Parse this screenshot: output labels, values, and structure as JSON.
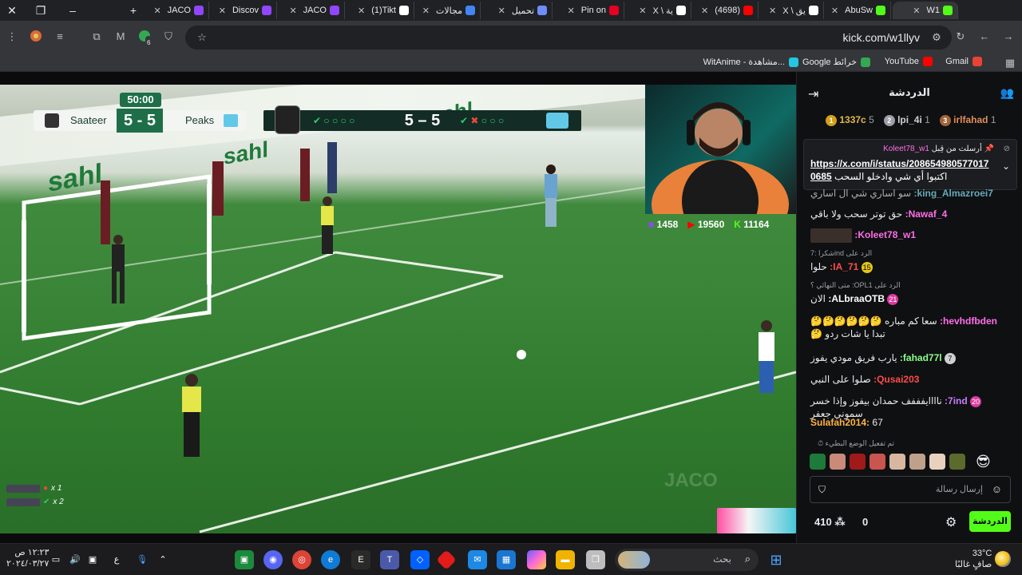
{
  "tabs": [
    {
      "label": "JACO",
      "color": "#9146ff"
    },
    {
      "label": "Discov",
      "color": "#9146ff"
    },
    {
      "label": "JACO",
      "color": "#9146ff"
    },
    {
      "label": "(1)Tikt",
      "color": "#ffffff"
    },
    {
      "label": "مجالات",
      "color": "#4285f4"
    },
    {
      "label": "تحميل",
      "color": "#6f8cff"
    },
    {
      "label": "Pin on",
      "color": "#e60023"
    },
    {
      "label": "X \\ ية",
      "color": "#ffffff"
    },
    {
      "label": "(4698)",
      "color": "#ff0000"
    },
    {
      "label": "X \\ يق",
      "color": "#ffffff"
    },
    {
      "label": "AbuSw",
      "color": "#53fc18"
    },
    {
      "label": "W1",
      "color": "#53fc18"
    }
  ],
  "toolbar": {
    "url": "kick.com/w1llyv",
    "extension_badge": "6"
  },
  "bookmarks": [
    {
      "label": "Gmail",
      "color": "#ea4335"
    },
    {
      "label": "YouTube",
      "color": "#ff0000"
    },
    {
      "label": "Google خرائط",
      "color": "#34a853"
    },
    {
      "label": "WitAnime - مشاهدة...",
      "color": "#23c7e0"
    }
  ],
  "scoreboard": {
    "time": "50:00",
    "team_left": "Saateer",
    "score": "5 - 5",
    "team_right": "Peaks",
    "pen_score": "5 – 5"
  },
  "stream_stats": {
    "twitch": "1458",
    "youtube": "19560",
    "kick": "11164"
  },
  "watermark": "JACO",
  "overlay_bottom_left": [
    {
      "label": "x 1"
    },
    {
      "label": "x 2"
    }
  ],
  "chat": {
    "title": "الدردشة",
    "leaderboard": [
      {
        "rank": "1",
        "name": "1337c",
        "count": "5"
      },
      {
        "rank": "2",
        "name": "lpi_4i",
        "count": "1"
      },
      {
        "rank": "3",
        "name": "irlfahad",
        "count": "1"
      }
    ],
    "pinned": {
      "by": "Koleet78_w1",
      "label": "أرسلت من قِبل",
      "link": "https://x.com/i/status/2086549805770170685",
      "text": "اكتبوا أي شي وادخلو السحب"
    },
    "messages": [
      {
        "user": "king_Almazroei7:",
        "text": "سو اساري شي ال اساري",
        "color": "#8be9ff"
      },
      {
        "user": "Nawaf_4:",
        "text": "حق توتر سحب ولا باقي",
        "color": "#ff6ee8"
      },
      {
        "user": "Koleet78_w1:",
        "text": "",
        "color": "#ff6ee8"
      },
      {
        "user": "IA_71:",
        "text": "حلوا",
        "color": "#ff4b4b",
        "reply": "شكرا :7ind الرد على",
        "badge": "15"
      },
      {
        "user": "ALbraaOTB:",
        "text": "الان",
        "color": "#ffffff",
        "reply": "متى النهائي ؟ :OPL1 الرد على",
        "badge": "21"
      },
      {
        "user": "hevhdfbden:",
        "text": "سعا كم مباره 🤔🤔🤔🤔🤔🤔 تبدا يا شات ردو 🤔",
        "color": "#ff6ee8"
      },
      {
        "user": "fahad77l:",
        "text": "يارب فريق مودي يفوز",
        "color": "#8bff8b",
        "badge": "7"
      },
      {
        "user": "Qusai203:",
        "text": "صلوا على النبي",
        "color": "#ff4b4b"
      },
      {
        "user": "7ind:",
        "text": "ناااايفففف حمدان بيفوز وإذا خسر سموني جعفر",
        "color": "#c77dff",
        "badge": "20"
      },
      {
        "user": "Sulafah2014:",
        "text": "67",
        "color": "#ffb347"
      }
    ],
    "slow_mode": "تم تفعيل الوضع البطيء",
    "input_placeholder": "إرسال رسالة",
    "send_label": "الدردشة",
    "points": "410",
    "points_zero": "0"
  },
  "taskbar": {
    "time": "١٢:٢٣ ص",
    "date": "٢٠٢٤/٠٣/٢٧",
    "weather_temp": "33°C",
    "weather_desc": "صافٍ غالبًا",
    "search_placeholder": "بحث",
    "lang": "ع"
  }
}
